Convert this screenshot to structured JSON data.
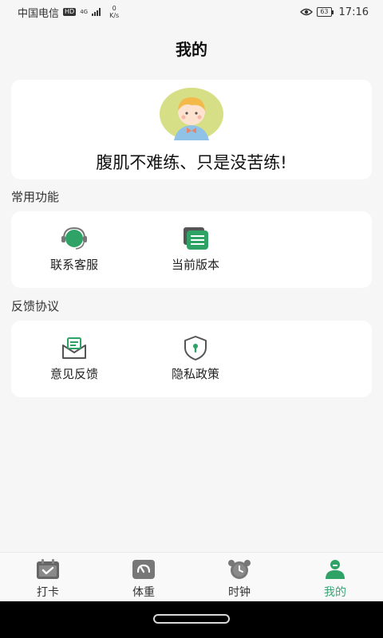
{
  "status_bar": {
    "carrier": "中国电信",
    "hd": "HD",
    "network": "4G",
    "speed_value": "0",
    "speed_unit": "K/s",
    "battery": "63",
    "time": "17:16"
  },
  "header": {
    "title": "我的"
  },
  "profile": {
    "motto": "腹肌不难练、只是没苦练!"
  },
  "common_functions": {
    "label": "常用功能",
    "items": [
      {
        "label": "联系客服",
        "icon": "headset-icon"
      },
      {
        "label": "当前版本",
        "icon": "version-icon"
      }
    ]
  },
  "feedback_section": {
    "label": "反馈协议",
    "items": [
      {
        "label": "意见反馈",
        "icon": "mail-icon"
      },
      {
        "label": "隐私政策",
        "icon": "shield-icon"
      }
    ]
  },
  "tabbar": {
    "items": [
      {
        "label": "打卡",
        "icon": "calendar-check-icon",
        "active": false
      },
      {
        "label": "体重",
        "icon": "scale-icon",
        "active": false
      },
      {
        "label": "时钟",
        "icon": "alarm-clock-icon",
        "active": false
      },
      {
        "label": "我的",
        "icon": "user-icon",
        "active": true
      }
    ]
  },
  "colors": {
    "accent": "#3aa574",
    "background": "#f6f6f6",
    "card": "#ffffff"
  }
}
